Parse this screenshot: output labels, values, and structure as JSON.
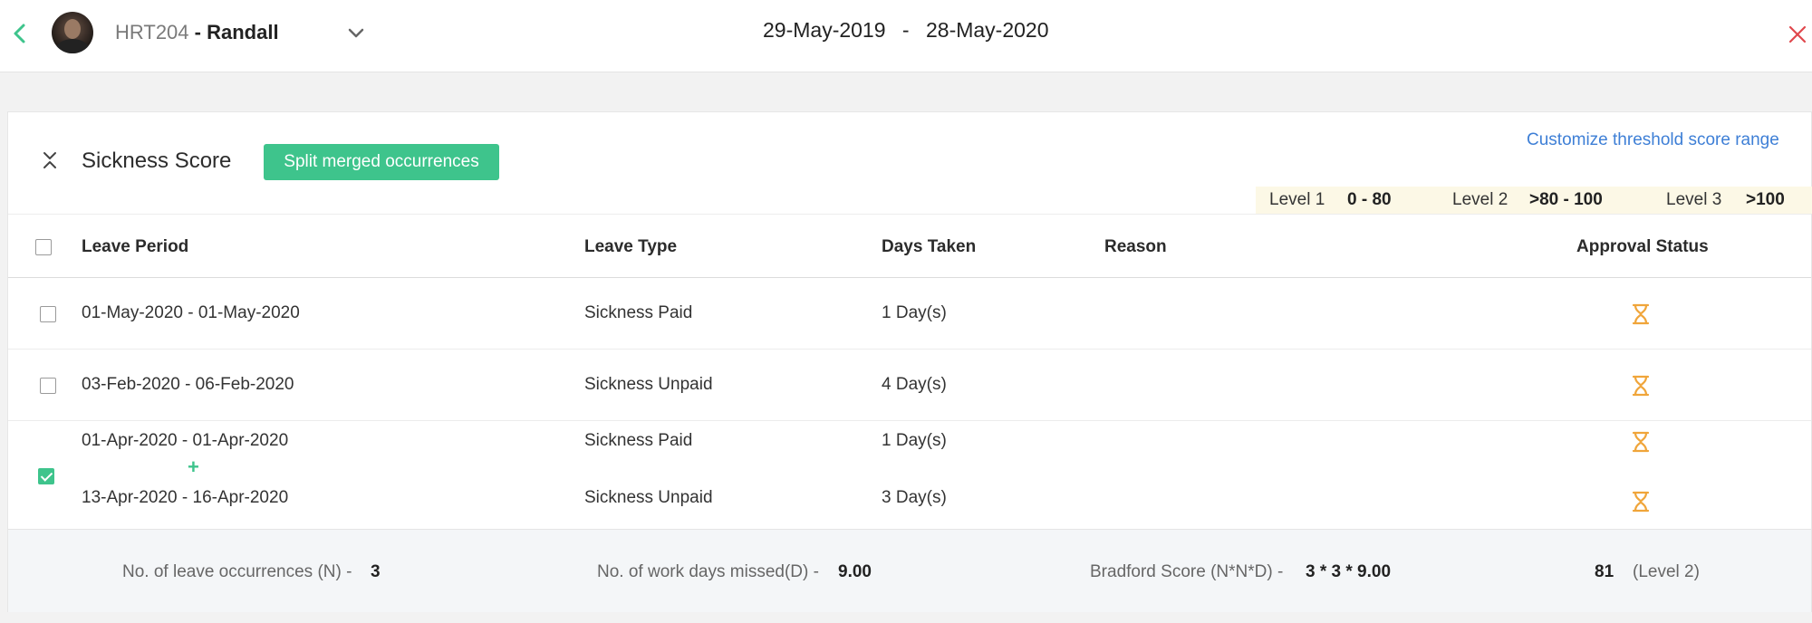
{
  "header": {
    "employee_code": "HRT204",
    "employee_separator": " - ",
    "employee_name": "Randall",
    "date_from": "29-May-2019",
    "date_sep": "-",
    "date_to": "28-May-2020"
  },
  "section": {
    "title": "Sickness Score",
    "split_button": "Split merged occurrences",
    "customize_link": "Customize threshold score range",
    "levels": [
      {
        "label": "Level 1",
        "range": "0 - 80"
      },
      {
        "label": "Level 2",
        "range": ">80 - 100"
      },
      {
        "label": "Level 3",
        "range": ">100"
      }
    ]
  },
  "table": {
    "columns": [
      "Leave Period",
      "Leave Type",
      "Days Taken",
      "Reason",
      "Approval Status"
    ],
    "rows": [
      {
        "period": "01-May-2020 - 01-May-2020",
        "type": "Sickness Paid",
        "days": "1 Day(s)",
        "reason": "",
        "checked": false
      },
      {
        "period": "03-Feb-2020 - 06-Feb-2020",
        "type": "Sickness Unpaid",
        "days": "4 Day(s)",
        "reason": "",
        "checked": false
      }
    ],
    "merged": {
      "checked": true,
      "plus": "+",
      "items": [
        {
          "period": "01-Apr-2020 - 01-Apr-2020",
          "type": "Sickness Paid",
          "days": "1 Day(s)",
          "reason": ""
        },
        {
          "period": "13-Apr-2020 - 16-Apr-2020",
          "type": "Sickness Unpaid",
          "days": "3 Day(s)",
          "reason": ""
        }
      ]
    }
  },
  "summary": {
    "occurrences_label": "No. of leave occurrences (N) -",
    "occurrences_value": "3",
    "days_label": "No. of work days missed(D) -",
    "days_value": "9.00",
    "bradford_label": "Bradford Score (N*N*D) -",
    "bradford_formula": "3 * 3 * 9.00",
    "score": "81",
    "level": "(Level 2)"
  },
  "colors": {
    "accent": "#3ec48c",
    "link": "#3e7fd6",
    "pending": "#f0a53a",
    "close": "#e0474c"
  }
}
